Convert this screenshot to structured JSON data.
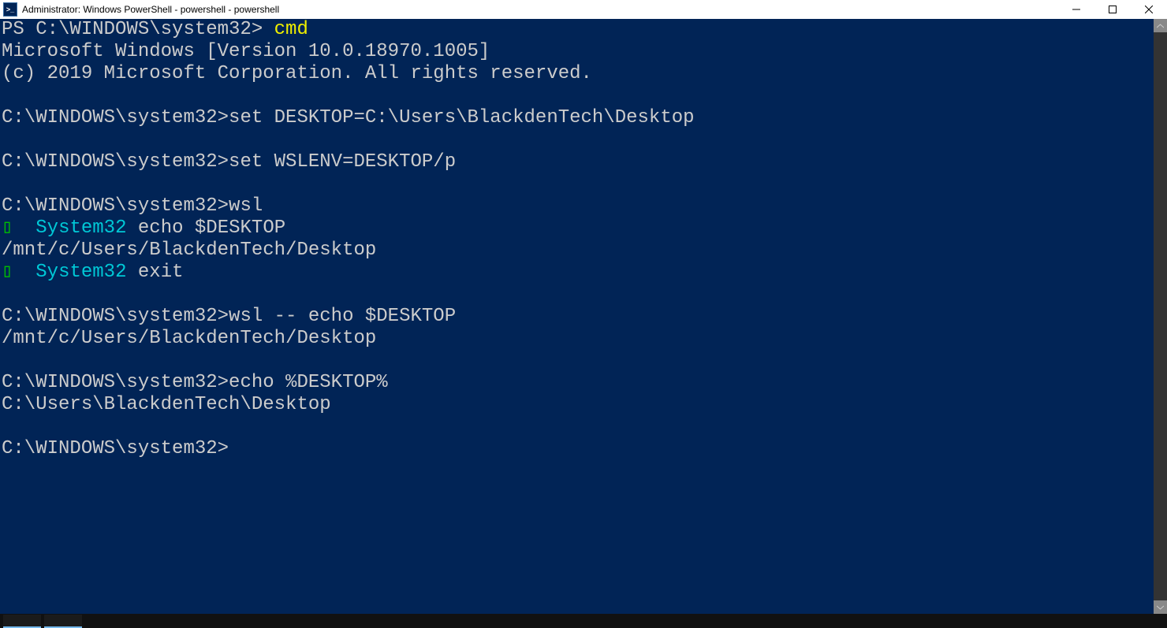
{
  "titlebar": {
    "icon_text": ">_",
    "title": "Administrator: Windows PowerShell - powershell - powershell"
  },
  "lines": {
    "l0a": "PS C:\\WINDOWS\\system32> ",
    "l0b": "cmd",
    "l1": "Microsoft Windows [Version 10.0.18970.1005]",
    "l2": "(c) 2019 Microsoft Corporation. All rights reserved.",
    "l3": "",
    "l4": "C:\\WINDOWS\\system32>set DESKTOP=C:\\Users\\BlackdenTech\\Desktop",
    "l5": "",
    "l6": "C:\\WINDOWS\\system32>set WSLENV=DESKTOP/p",
    "l7": "",
    "l8": "C:\\WINDOWS\\system32>wsl",
    "l9a": "▯",
    "l9b": "  System32",
    "l9c": " echo $DESKTOP",
    "l10": "/mnt/c/Users/BlackdenTech/Desktop",
    "l11a": "▯",
    "l11b": "  System32",
    "l11c": " exit",
    "l12": "",
    "l13": "C:\\WINDOWS\\system32>wsl -- echo $DESKTOP",
    "l14": "/mnt/c/Users/BlackdenTech/Desktop",
    "l15": "",
    "l16": "C:\\WINDOWS\\system32>echo %DESKTOP%",
    "l17": "C:\\Users\\BlackdenTech\\Desktop",
    "l18": "",
    "l19": "C:\\WINDOWS\\system32>"
  }
}
